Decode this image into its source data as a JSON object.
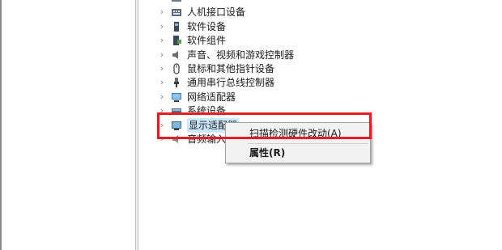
{
  "device_tree": {
    "items": [
      {
        "label": "人机接口设备",
        "icon": "keyboard-icon"
      },
      {
        "label": "软件设备",
        "icon": "software-device-icon"
      },
      {
        "label": "软件组件",
        "icon": "software-component-icon"
      },
      {
        "label": "声音、视频和游戏控制器",
        "icon": "speaker-icon"
      },
      {
        "label": "鼠标和其他指针设备",
        "icon": "mouse-icon"
      },
      {
        "label": "通用串行总线控制器",
        "icon": "usb-icon"
      },
      {
        "label": "网络适配器",
        "icon": "network-adapter-icon"
      },
      {
        "label": "系统设备",
        "icon": "system-device-icon"
      },
      {
        "label": "显示适配器",
        "icon": "display-adapter-icon"
      },
      {
        "label": "音频输入和",
        "icon": "audio-input-icon"
      }
    ],
    "expander_glyph": "›"
  },
  "context_menu": {
    "items": [
      {
        "label": "扫描检测硬件改动(A)"
      },
      {
        "label": "属性(R)"
      }
    ]
  },
  "colors": {
    "highlight_border": "#e51c23",
    "selection": "#cce8ff",
    "menu_background": "#f2f2f2"
  }
}
